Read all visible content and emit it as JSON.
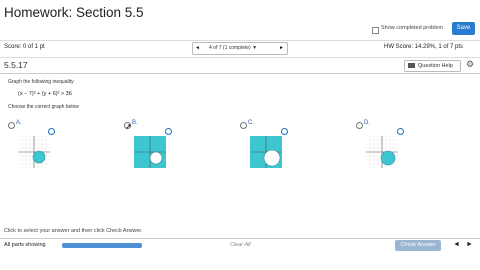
{
  "header": {
    "title": "Homework: Section 5.5",
    "show_completed_label": "Show completed problem",
    "save_label": "Save"
  },
  "scorebar": {
    "score_text": "Score: 0 of 1 pt",
    "nav_prev": "◄",
    "nav_text": "4 of 7 (1 complete) ▼",
    "nav_next": "►",
    "hw_score_text": "HW Score: 14.29%, 1 of 7 pts"
  },
  "question": {
    "number": "5.5.17",
    "help_label": "Question Help",
    "instruction": "Graph the following inequality",
    "inequality": "(x − 7)² + (y + 6)² > 36",
    "choose_text": "Choose the correct graph below",
    "options": [
      {
        "letter": "A.",
        "shaded": "inside"
      },
      {
        "letter": "B.",
        "shaded": "outside"
      },
      {
        "letter": "C.",
        "shaded": "outside"
      },
      {
        "letter": "D.",
        "shaded": "inside"
      }
    ],
    "graph_tick_label": "15"
  },
  "footer": {
    "instruction": "Click to select your answer and then click Check Answer.",
    "all_parts_label": "All parts showing",
    "clear_all_label": "Clear All",
    "check_answer_label": "Check Answer",
    "prev_arrow": "◄",
    "next_arrow": "►"
  },
  "colors": {
    "accent": "#2a7bd0",
    "shade": "#3cc6cf"
  }
}
